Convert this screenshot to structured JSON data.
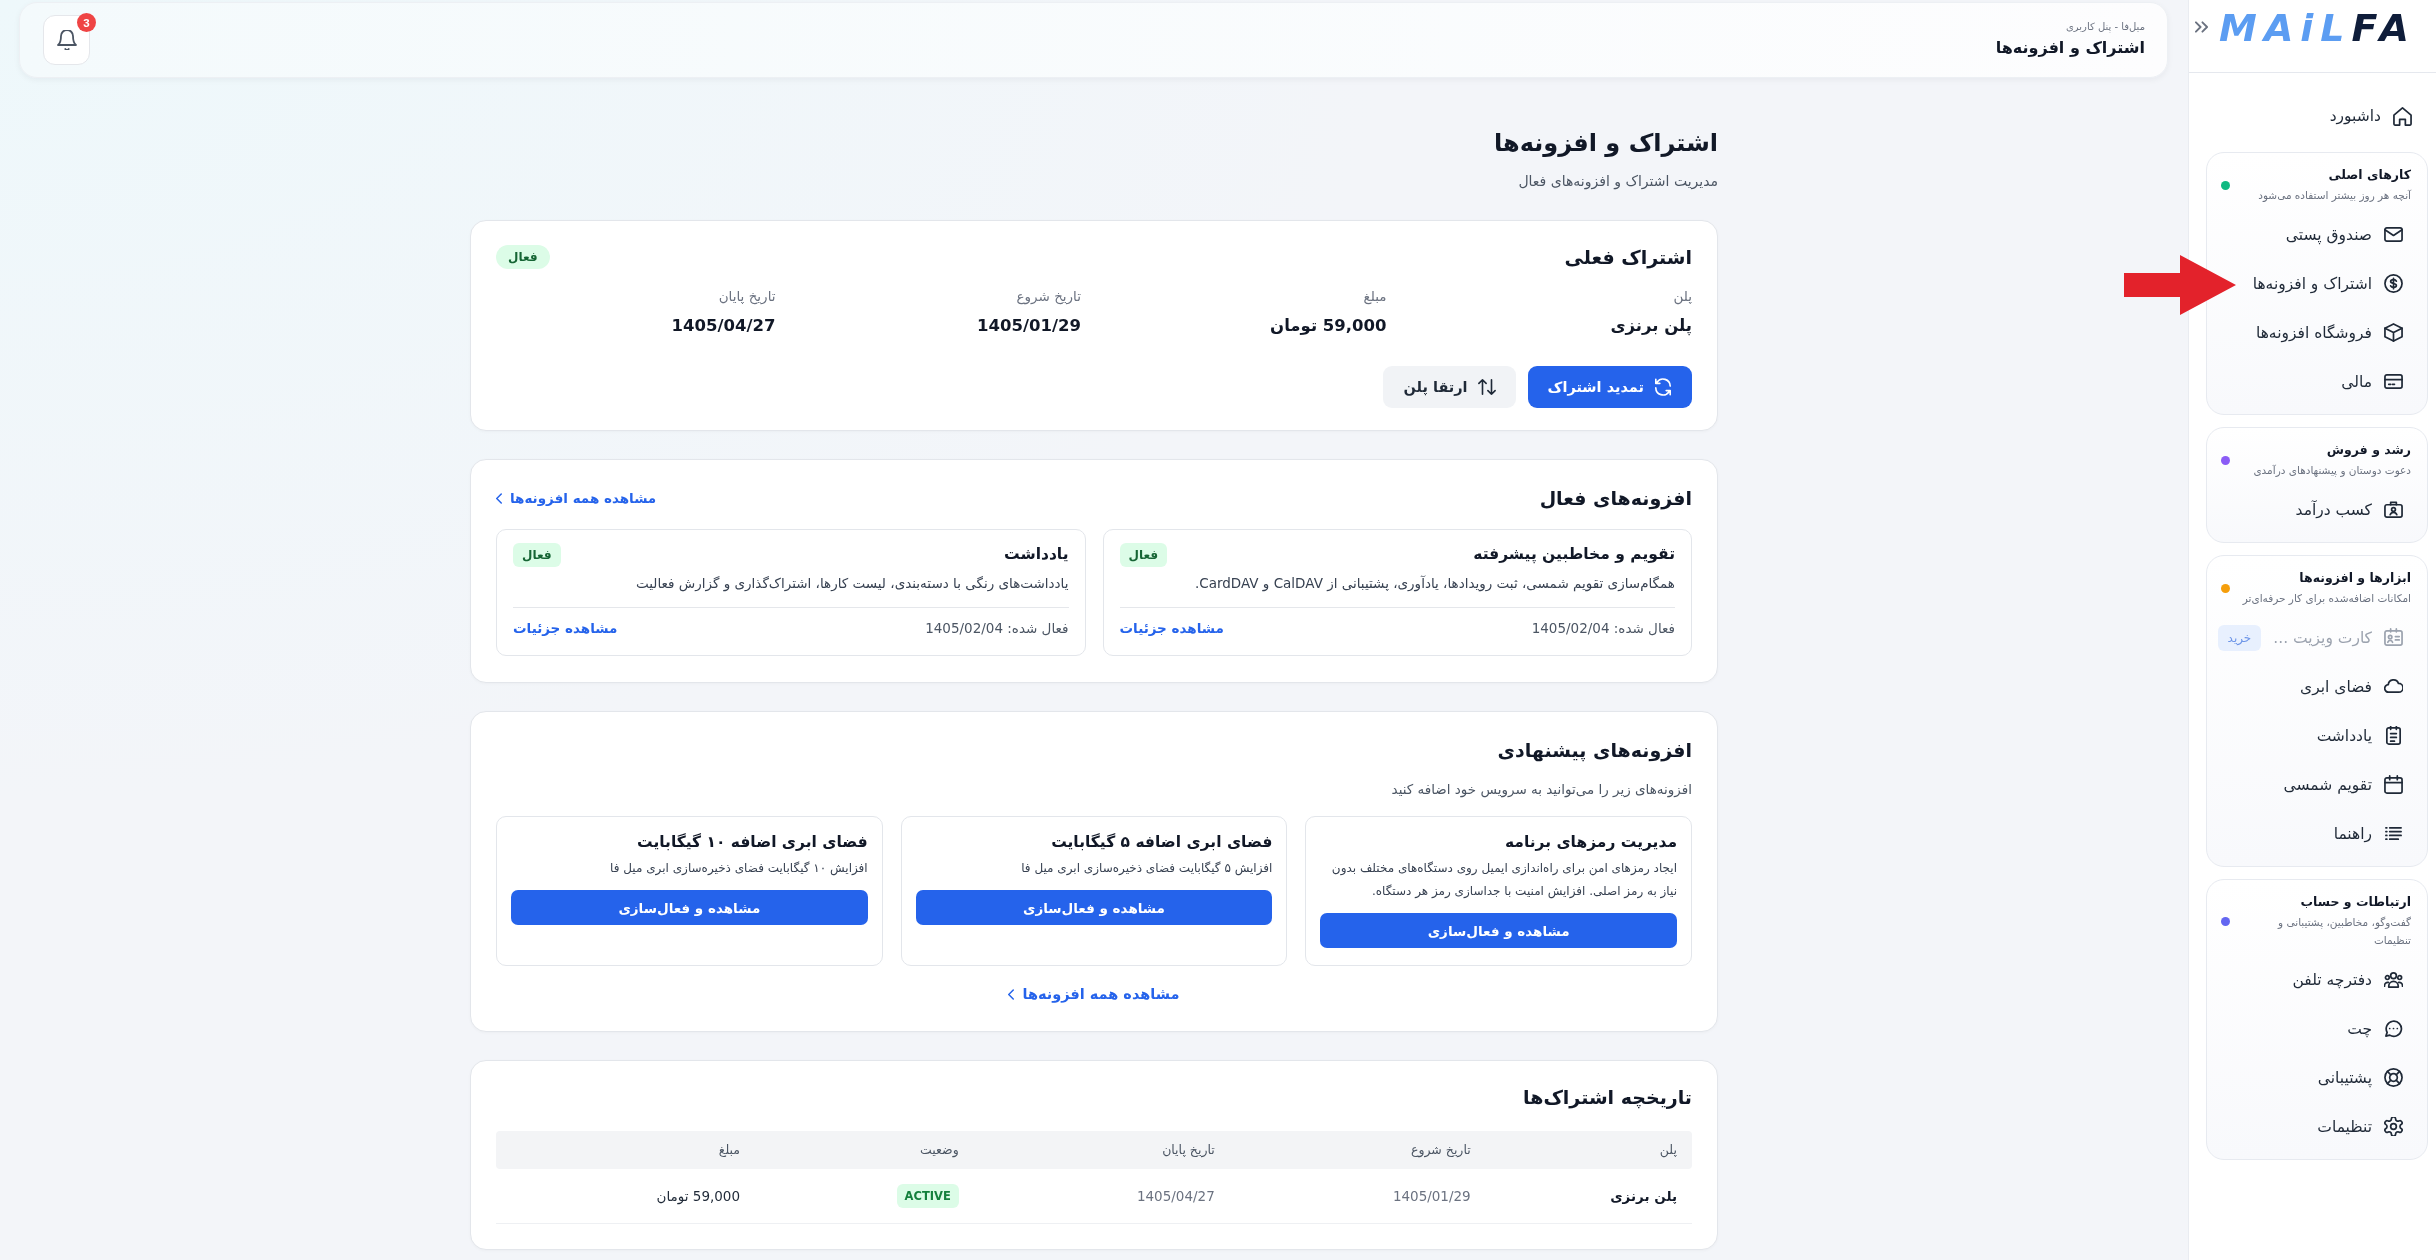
{
  "sidebar": {
    "logo": {
      "text_1": "MAiL",
      "text_2": "FA"
    },
    "dashboard": {
      "label": "داشبورد"
    },
    "groups": [
      {
        "title": "کارهای اصلی",
        "subtitle": "آنچه هر روز بیشتر استفاده می‌شود",
        "color": "#10b981",
        "items": [
          {
            "label": "صندوق پستی",
            "disabled": false
          },
          {
            "label": "اشتراک و افزونه‌ها",
            "disabled": false
          },
          {
            "label": "فروشگاه افزونه‌ها",
            "disabled": false
          },
          {
            "label": "مالی",
            "disabled": false
          }
        ]
      },
      {
        "title": "رشد و فروش",
        "subtitle": "دعوت دوستان و پیشنهادهای درآمدی",
        "color": "#8b5cf6",
        "items": [
          {
            "label": "کسب درآمد",
            "disabled": false
          }
        ]
      },
      {
        "title": "ابزارها و افزونه‌ها",
        "subtitle": "امکانات اضافه‌شده برای کار حرفه‌ای‌تر",
        "color": "#f59e0b",
        "items": [
          {
            "label": "کارت ویزیت ...",
            "disabled": true,
            "badge": "خرید"
          },
          {
            "label": "فضای ابری",
            "disabled": false
          },
          {
            "label": "یادداشت",
            "disabled": false
          },
          {
            "label": "تقویم شمسی",
            "disabled": false
          },
          {
            "label": "راهنما",
            "disabled": false
          }
        ]
      },
      {
        "title": "ارتباطات و حساب",
        "subtitle": "گفت‌وگو، مخاطبین، پشتیبانی و تنظیمات",
        "color": "#6366f1",
        "items": [
          {
            "label": "دفترچه تلفن",
            "disabled": false
          },
          {
            "label": "چت",
            "disabled": false
          },
          {
            "label": "پشتیبانی",
            "disabled": false
          },
          {
            "label": "تنظیمات",
            "disabled": false
          }
        ]
      }
    ]
  },
  "top_bar": {
    "breadcrumb": "میل‌فا - پنل کاربری",
    "title": "اشتراک و افزونه‌ها",
    "notification_count": "3"
  },
  "page": {
    "title": "اشتراک و افزونه‌ها",
    "subtitle": "مدیریت اشتراک و افزونه‌های فعال"
  },
  "current_subscription": {
    "title": "اشتراک فعلی",
    "status": "فعال",
    "fields": [
      {
        "label": "پلن",
        "value": "پلن برنزی"
      },
      {
        "label": "مبلغ",
        "value": "59,000 تومان"
      },
      {
        "label": "تاریخ شروع",
        "value": "1405/01/29"
      },
      {
        "label": "تاریخ پایان",
        "value": "1405/04/27"
      }
    ],
    "buttons": [
      {
        "label": "تمدید اشتراک",
        "kind": "primary"
      },
      {
        "label": "ارتقا پلن",
        "kind": "secondary"
      }
    ]
  },
  "active_addons": {
    "title": "افزونه‌های فعال",
    "link": "مشاهده همه افزونه‌ها",
    "items": [
      {
        "title": "تقویم و مخاطبین پیشرفته",
        "status": "فعال",
        "description": "همگام‌سازی تقویم شمسی، ثبت رویدادها، یادآوری، پشتیبانی از CalDAV و CardDAV.",
        "activated": "فعال شده: 1405/02/04",
        "link": "مشاهده جزئیات"
      },
      {
        "title": "یادداشت",
        "status": "فعال",
        "description": "یادداشت‌های رنگی با دسته‌بندی، لیست کارها، اشتراک‌گذاری و گزارش فعالیت",
        "activated": "فعال شده: 1405/02/04",
        "link": "مشاهده جزئیات"
      }
    ]
  },
  "suggested_addons": {
    "title": "افزونه‌های پیشنهادی",
    "subtitle": "افزونه‌های زیر را می‌توانید به سرویس خود اضافه کنید",
    "items": [
      {
        "title": "مدیریت رمزهای برنامه",
        "description": "ایجاد رمزهای امن برای راه‌اندازی ایمیل روی دستگاه‌های مختلف بدون نیاز به رمز اصلی. افزایش امنیت با جداسازی رمز هر دستگاه.",
        "button": "مشاهده و فعال‌سازی"
      },
      {
        "title": "فضای ابری اضافه ۵ گیگابایت",
        "description": "افزایش ۵ گیگابایت فضای ذخیره‌سازی ابری میل فا",
        "button": "مشاهده و فعال‌سازی"
      },
      {
        "title": "فضای ابری اضافه ۱۰ گیگابایت",
        "description": "افزایش ۱۰ گیگابایت فضای ذخیره‌سازی ابری میل فا",
        "button": "مشاهده و فعال‌سازی"
      }
    ],
    "link": "مشاهده همه افزونه‌ها"
  },
  "subscription_history": {
    "title": "تاریخچه اشتراک‌ها",
    "columns": [
      "پلن",
      "تاریخ شروع",
      "تاریخ پایان",
      "وضعیت",
      "مبلغ"
    ],
    "rows": [
      {
        "plan": "پلن برنزی",
        "start": "1405/01/29",
        "end": "1405/04/27",
        "status": "ACTIVE",
        "amount": "59,000 تومان"
      }
    ]
  }
}
